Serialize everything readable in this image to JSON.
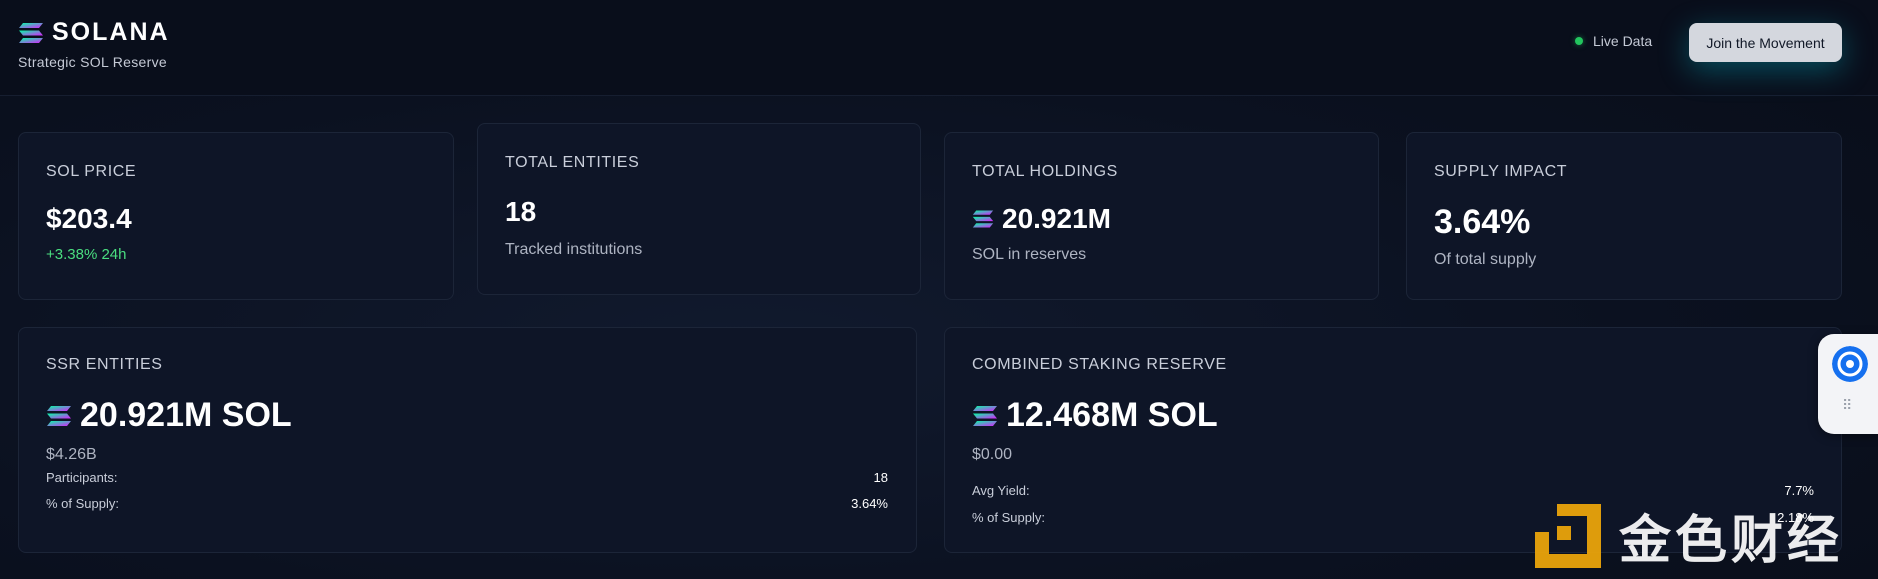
{
  "header": {
    "brand_name": "SOLANA",
    "subtitle": "Strategic SOL Reserve",
    "live_label": "Live Data",
    "join_button": "Join the Movement"
  },
  "cards": {
    "sol_price": {
      "label": "SOL PRICE",
      "value": "$203.4",
      "change": "+3.38% 24h"
    },
    "total_entities": {
      "label": "TOTAL ENTITIES",
      "value": "18",
      "sub": "Tracked institutions"
    },
    "total_holdings": {
      "label": "TOTAL HOLDINGS",
      "value": "20.921M",
      "sub": "SOL in reserves"
    },
    "supply_impact": {
      "label": "SUPPLY IMPACT",
      "value": "3.64%",
      "sub": "Of total supply"
    },
    "ssr_entities": {
      "label": "SSR ENTITIES",
      "value": "20.921M SOL",
      "usd": "$4.26B",
      "rows": [
        {
          "label": "Participants:",
          "value": "18"
        },
        {
          "label": "% of Supply:",
          "value": "3.64%"
        }
      ]
    },
    "combined_staking": {
      "label": "COMBINED STAKING RESERVE",
      "value": "12.468M SOL",
      "usd": "$0.00",
      "rows": [
        {
          "label": "Avg Yield:",
          "value": "7.7%"
        },
        {
          "label": "% of Supply:",
          "value": "2.18%"
        }
      ]
    }
  },
  "watermark": {
    "text": "金色财经"
  },
  "colors": {
    "background": "#0b1120",
    "card": "#0e1527",
    "positive": "#4ade80",
    "live_dot": "#22c55e",
    "button": "#d4d7de",
    "watermark_gold": "#f0a80a"
  },
  "icons": {
    "brand": "solana-logo-icon",
    "widget": "chat-bubble-icon"
  }
}
